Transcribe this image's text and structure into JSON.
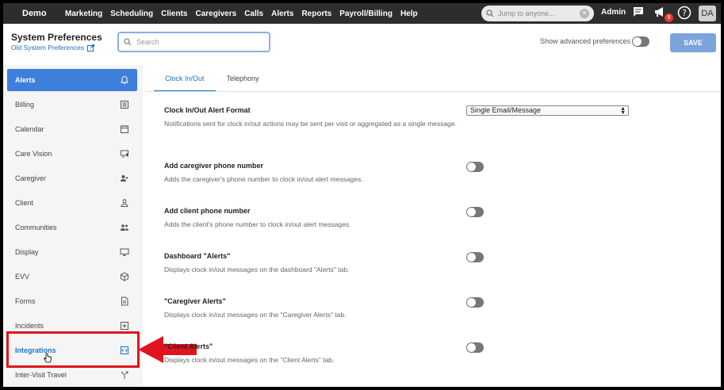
{
  "nav": {
    "brand": "Demo",
    "items": [
      "Marketing",
      "Scheduling",
      "Clients",
      "Caregivers",
      "Calls",
      "Alerts",
      "Reports",
      "Payroll/Billing",
      "Help"
    ],
    "jump_placeholder": "Jump to anyone...",
    "admin": "Admin",
    "notification_count": "9",
    "avatar": "DA"
  },
  "header": {
    "title": "System Preferences",
    "old_link": "Old System Preferences",
    "search_placeholder": "Search",
    "advanced_label": "Show advanced preferences",
    "advanced_on": false,
    "save": "SAVE"
  },
  "sidebar": {
    "items": [
      {
        "label": "Alerts",
        "icon": "bell-icon"
      },
      {
        "label": "Billing",
        "icon": "receipt-icon"
      },
      {
        "label": "Calendar",
        "icon": "calendar-icon"
      },
      {
        "label": "Care Vision",
        "icon": "care-vision-icon"
      },
      {
        "label": "Caregiver",
        "icon": "caregiver-icon"
      },
      {
        "label": "Client",
        "icon": "person-icon"
      },
      {
        "label": "Communities",
        "icon": "group-icon"
      },
      {
        "label": "Display",
        "icon": "monitor-icon"
      },
      {
        "label": "EVV",
        "icon": "cube-icon"
      },
      {
        "label": "Forms",
        "icon": "document-icon"
      },
      {
        "label": "Incidents",
        "icon": "plus-box-icon"
      },
      {
        "label": "Integrations",
        "icon": "integration-icon"
      },
      {
        "label": "Inter-Visit Travel",
        "icon": "split-arrow-icon"
      }
    ],
    "active": "Alerts",
    "highlighted": "Integrations"
  },
  "tabs": [
    "Clock In/Out",
    "Telephony"
  ],
  "settings": [
    {
      "title": "Clock In/Out Alert Format",
      "desc": "Notifications sent for clock in/out actions may be sent per visit or aggregated as a single message.",
      "control": "select",
      "value": "Single Email/Message"
    },
    {
      "title": "Add caregiver phone number",
      "desc": "Adds the caregiver's phone number to clock in/out alert messages.",
      "control": "toggle",
      "on": false
    },
    {
      "title": "Add client phone number",
      "desc": "Adds the client's phone number to clock in/out alert messages.",
      "control": "toggle",
      "on": false
    },
    {
      "title": "Dashboard \"Alerts\"",
      "desc": "Displays clock in/out messages on the dashboard \"Alerts\" tab.",
      "control": "toggle",
      "on": false
    },
    {
      "title": "\"Caregiver Alerts\"",
      "desc": "Displays clock in/out messages on the \"Caregiver Alerts\" tab.",
      "control": "toggle",
      "on": false
    },
    {
      "title": "\"Client Alerts\"",
      "desc": "Displays clock in/out messages on the \"Client Alerts\" tab.",
      "control": "toggle",
      "on": false
    }
  ],
  "colors": {
    "accent": "#3f7fdc",
    "annotation": "#e0141e",
    "nav_bg": "#2d2d2d"
  }
}
